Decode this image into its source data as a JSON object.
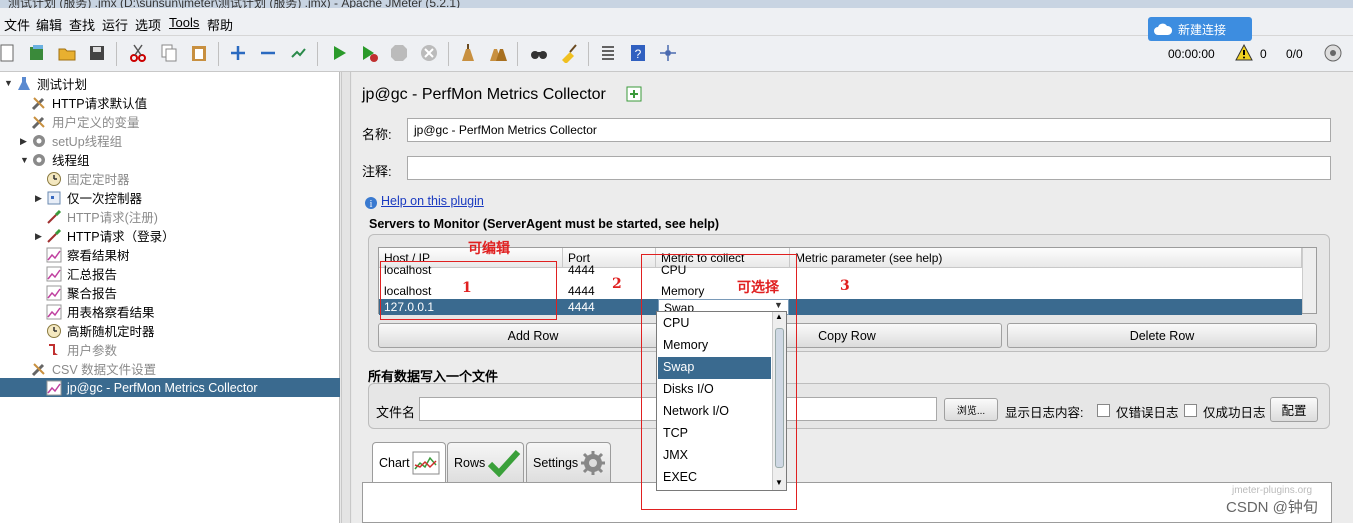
{
  "window": {
    "title": "测试计划 (服务) .jmx (D:\\sunsun\\jmeter\\测试计划 (服务) .jmx) - Apache JMeter (5.2.1)"
  },
  "menu": [
    "文件",
    "编辑",
    "查找",
    "运行",
    "选项",
    "Tools",
    "帮助"
  ],
  "status": {
    "timer": "00:00:00",
    "warnings": "0",
    "threads": "0/0",
    "cloud_label": "新建连接"
  },
  "tree": {
    "items": [
      {
        "label": "测试计划",
        "icon": "flask-icon",
        "disabled": false,
        "selected": false
      },
      {
        "label": "HTTP请求默认值",
        "icon": "wrench-icon",
        "disabled": false,
        "selected": false
      },
      {
        "label": "用户定义的变量",
        "icon": "wrench-icon",
        "disabled": true,
        "selected": false
      },
      {
        "label": "setUp线程组",
        "icon": "gear-icon",
        "disabled": true,
        "selected": false
      },
      {
        "label": "线程组",
        "icon": "gear-icon",
        "disabled": false,
        "selected": false
      },
      {
        "label": "固定定时器",
        "icon": "timer-icon",
        "disabled": true,
        "selected": false
      },
      {
        "label": "仅一次控制器",
        "icon": "controller-icon",
        "disabled": false,
        "selected": false
      },
      {
        "label": "HTTP请求(注册)",
        "icon": "pipette-icon",
        "disabled": true,
        "selected": false
      },
      {
        "label": "HTTP请求（登录）",
        "icon": "pipette-icon",
        "disabled": false,
        "selected": false
      },
      {
        "label": "察看结果树",
        "icon": "graph-icon",
        "disabled": false,
        "selected": false
      },
      {
        "label": "汇总报告",
        "icon": "graph-icon",
        "disabled": false,
        "selected": false
      },
      {
        "label": "聚合报告",
        "icon": "graph-icon",
        "disabled": false,
        "selected": false
      },
      {
        "label": "用表格察看结果",
        "icon": "graph-icon",
        "disabled": false,
        "selected": false
      },
      {
        "label": "高斯随机定时器",
        "icon": "timer-icon",
        "disabled": false,
        "selected": false
      },
      {
        "label": "用户参数",
        "icon": "preprocessor-icon",
        "disabled": true,
        "selected": false
      },
      {
        "label": "CSV 数据文件设置",
        "icon": "wrench-icon",
        "disabled": true,
        "selected": false
      },
      {
        "label": "jp@gc - PerfMon Metrics Collector",
        "icon": "graph-icon",
        "disabled": false,
        "selected": true
      }
    ]
  },
  "panel": {
    "title": "jp@gc - PerfMon Metrics Collector",
    "name_label": "名称:",
    "name_value": "jp@gc - PerfMon Metrics Collector",
    "comment_label": "注释:",
    "comment_value": "",
    "help_link": "Help on this plugin",
    "servers_title": "Servers to Monitor (ServerAgent must be started, see help)",
    "columns": [
      "Host / IP",
      "Port",
      "Metric to collect",
      "Metric parameter (see help)"
    ],
    "rows": [
      {
        "host": "localhost",
        "port": "4444",
        "metric": "CPU",
        "param": ""
      },
      {
        "host": "localhost",
        "port": "4444",
        "metric": "Memory",
        "param": ""
      },
      {
        "host": "127.0.0.1",
        "port": "4444",
        "metric": "Swap",
        "param": ""
      }
    ],
    "add_row": "Add Row",
    "copy_row": "Copy Row",
    "delete_row": "Delete Row",
    "file_section": "所有数据写入一个文件",
    "file_label": "文件名",
    "file_value": "",
    "browse": "浏览...",
    "log_label": "显示日志内容:",
    "errors_only": "仅错误日志",
    "success_only": "仅成功日志",
    "configure": "配置",
    "tabs": [
      "Chart",
      "Rows",
      "Settings"
    ]
  },
  "dropdown": {
    "options": [
      "CPU",
      "Memory",
      "Swap",
      "Disks I/O",
      "Network I/O",
      "TCP",
      "JMX",
      "EXEC"
    ],
    "selected": "Swap"
  },
  "annotations": {
    "editable": "可编辑",
    "selectable": "可选择",
    "n1": "1",
    "n2": "2",
    "n3": "3"
  },
  "watermark": {
    "text": "CSDN @钟旬",
    "plugin_site": "jmeter-plugins.org"
  }
}
